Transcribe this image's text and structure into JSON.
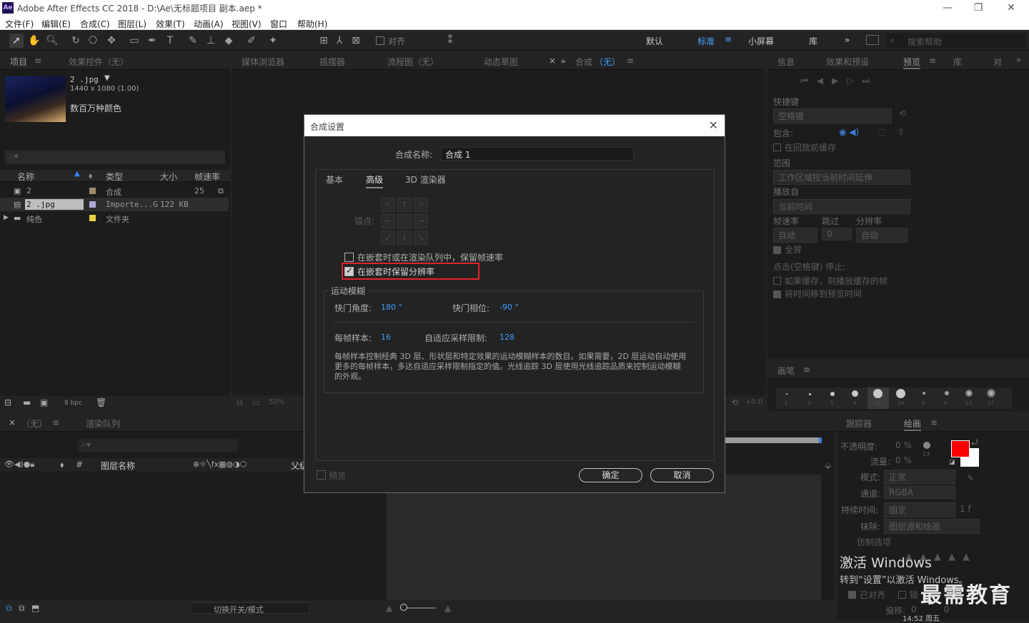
{
  "window": {
    "logo": "Ae",
    "title": "Adobe After Effects CC 2018 - D:\\Ae\\无标题项目 副本.aep *",
    "minimize": "—",
    "restore": "❐",
    "close": "✕"
  },
  "menu": [
    "文件(F)",
    "编辑(E)",
    "合成(C)",
    "图层(L)",
    "效果(T)",
    "动画(A)",
    "视图(V)",
    "窗口",
    "帮助(H)"
  ],
  "toolbar": {
    "align_label": "对齐",
    "workspaces": [
      "默认",
      "标准",
      "小屏幕",
      "库"
    ],
    "more": "»",
    "search_placeholder": "搜索帮助"
  },
  "project_panel": {
    "tab_project": "项目",
    "tab_effects": "效果控件（无）",
    "asset_name": "2 .jpg",
    "asset_dims": "1440 x 1080 (1.00)",
    "asset_color": "数百万种颜色",
    "columns": [
      "名称",
      "类型",
      "大小",
      "帧速率"
    ],
    "rows": [
      {
        "name": "2",
        "color": "#a08a6a",
        "type": "合成",
        "size": "",
        "fps": "25"
      },
      {
        "name": "2 .jpg",
        "color": "#b2a8d8",
        "type": "Importe...G",
        "size": "122 KB",
        "fps": ""
      },
      {
        "name": "纯色",
        "color": "#e6d143",
        "type": "文件夹",
        "size": "",
        "fps": ""
      }
    ],
    "bpc": "8 bpc"
  },
  "viewer_tabs": {
    "media": "媒体浏览器",
    "wiggler": "摇摆器",
    "flowchart": "流程图（无）",
    "sketch": "动态草图",
    "comp_prefix": "合成",
    "comp_name": "（无）",
    "zoom": "50%",
    "exposure": "+0.0"
  },
  "right_panel": {
    "tabs": [
      "信息",
      "效果和预设",
      "预览",
      "库",
      "对"
    ],
    "shortcut_label": "快捷键",
    "shortcut_value": "空格键",
    "include_label": "包含:",
    "cache_before": "在回放前缓存",
    "range_label": "范围",
    "range_value": "工作区域按当前时间延伸",
    "play_from_label": "播放自",
    "play_from_value": "当前时间",
    "fps_label": "帧速率",
    "skip_label": "跳过",
    "res_label": "分辨率",
    "fps_value": "自动",
    "skip_value": "0",
    "res_value": "自动",
    "fullscreen": "全屏",
    "stop_label": "点击(空格键) 停止:",
    "opt_cache": "如果缓存，则播放缓存的帧",
    "opt_move": "将时间移到预览时间",
    "brush_tab": "画笔",
    "brush_sizes": [
      "1",
      "3",
      "5",
      "9",
      "13",
      "19",
      "5",
      "9",
      "13",
      "17"
    ]
  },
  "timeline": {
    "tab_none": "（无）",
    "tab_render": "渲染队列",
    "layer_name_col": "图层名称",
    "parent_col": "父级",
    "toggle_label": "切换开关/模式"
  },
  "paint_panel": {
    "tab_tracker": "跟踪器",
    "tab_paint": "绘画",
    "opacity_label": "不透明度:",
    "opacity_value": "0 %",
    "flow_label": "流量:",
    "flow_value": "0 %",
    "mode_label": "模式:",
    "mode_value": "正常",
    "channel_label": "通道:",
    "channel_value": "RGBA",
    "duration_label": "持续时间:",
    "duration_value": "固定",
    "duration_frames": "1 f",
    "erase_label": "抹除:",
    "erase_value": "图层源和绘画",
    "clone_label": "仿制选项",
    "aligned_label": "已对齐",
    "lock_label": "锁",
    "offset_label": "偏移:",
    "offset_x": "0",
    "offset_y": "0",
    "brush_size_small": "13",
    "fg_color": "#ff0000",
    "bg_color": "#ffffff"
  },
  "overlay": {
    "activate_title": "激活 Windows",
    "activate_sub": "转到“设置”以激活 Windows。",
    "watermark": "最需教育",
    "taskbar_time": "14:52 周五"
  },
  "dialog": {
    "title": "合成设置",
    "close": "✕",
    "name_label": "合成名称:",
    "name_value": "合成 1",
    "tabs": [
      "基本",
      "高级",
      "3D 渲染器"
    ],
    "active_tab": "高级",
    "anchor_label": "锚点:",
    "opt_preserve_fps": "在嵌套时或在渲染队列中，保留帧速率",
    "opt_preserve_res": "在嵌套时保留分辨率",
    "motion_blur_label": "运动模糊",
    "shutter_angle_label": "快门角度:",
    "shutter_angle_value": "180 °",
    "shutter_phase_label": "快门相位:",
    "shutter_phase_value": "-90 °",
    "samples_label": "每帧样本:",
    "samples_value": "16",
    "adaptive_label": "自适应采样限制:",
    "adaptive_value": "128",
    "description": "每帧样本控制经典 3D 层、形状层和特定效果的运动模糊样本的数目。如果需要，2D 层运动自动使用更多的每帧样本，多达自适应采样限制指定的值。光线追踪 3D 层使用光线追踪品质来控制运动模糊的外观。",
    "preview_label": "预览",
    "ok_label": "确定",
    "cancel_label": "取消",
    "highlight_color": "#e0232b"
  }
}
